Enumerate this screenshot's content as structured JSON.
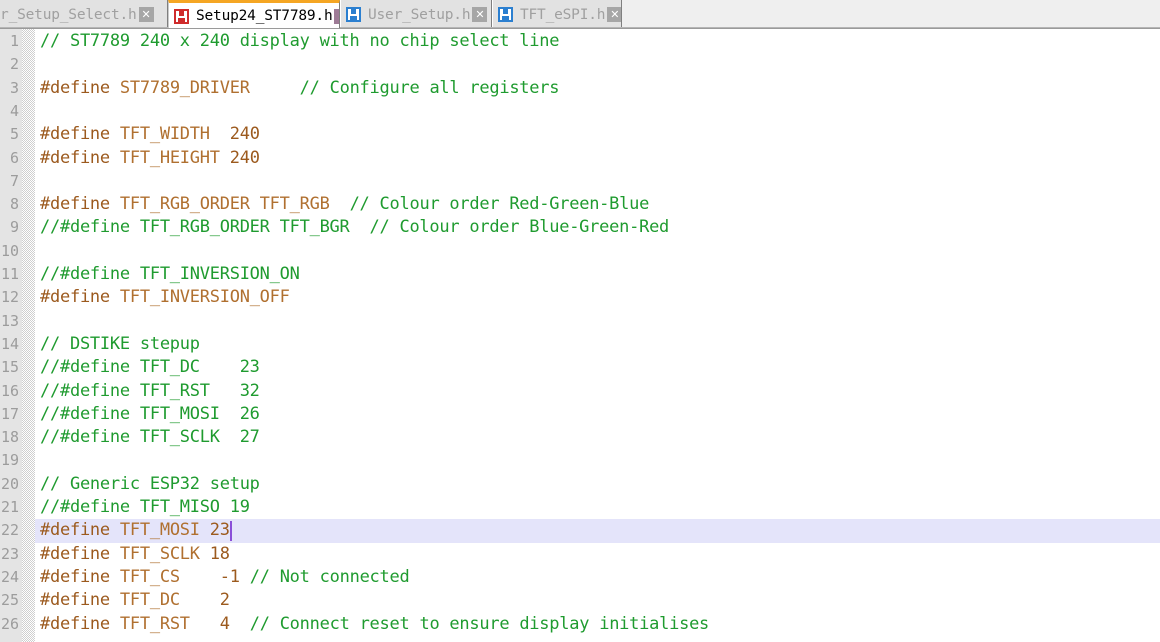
{
  "window": {
    "title": "Setup24_ST7789.h",
    "accent_color": "#f5a623",
    "current_line_highlight_color": "#e4e4fa",
    "caret_color": "#8a4fd8"
  },
  "tabbar": {
    "tabs": [
      {
        "label": "ser_Setup_Select.h",
        "full_label": "User_Setup_Select.h",
        "active": false,
        "clipped": true,
        "icon": "floppy-disk-icon",
        "icon_color": "#2b7fd0",
        "close_label": "✕"
      },
      {
        "label": "Setup24_ST7789.h",
        "active": true,
        "clipped": false,
        "icon": "floppy-disk-icon",
        "icon_color": "#cf2b2b",
        "close_label": "✕"
      },
      {
        "label": "User_Setup.h",
        "active": false,
        "clipped": false,
        "icon": "floppy-disk-icon",
        "icon_color": "#2b7fd0",
        "close_label": "✕"
      },
      {
        "label": "TFT_eSPI.h",
        "active": false,
        "clipped": false,
        "icon": "floppy-disk-icon",
        "icon_color": "#2b7fd0",
        "close_label": "✕"
      }
    ]
  },
  "editor": {
    "current_line": 22,
    "caret_column": 20,
    "line_numbers": [
      "1",
      "2",
      "3",
      "4",
      "5",
      "6",
      "7",
      "8",
      "9",
      "10",
      "11",
      "12",
      "13",
      "14",
      "15",
      "16",
      "17",
      "18",
      "19",
      "20",
      "21",
      "22",
      "23",
      "24",
      "25",
      "26"
    ],
    "lines": [
      {
        "n": 1,
        "tokens": [
          {
            "t": "// ST7789 240 x 240 display with no chip select line",
            "c": "com"
          }
        ]
      },
      {
        "n": 2,
        "tokens": []
      },
      {
        "n": 3,
        "tokens": [
          {
            "t": "#define ",
            "c": "pre"
          },
          {
            "t": "ST7789_DRIVER",
            "c": "id"
          },
          {
            "t": "     ",
            "c": "pln"
          },
          {
            "t": "// Configure all registers",
            "c": "com"
          }
        ]
      },
      {
        "n": 4,
        "tokens": []
      },
      {
        "n": 5,
        "tokens": [
          {
            "t": "#define ",
            "c": "pre"
          },
          {
            "t": "TFT_WIDTH",
            "c": "id"
          },
          {
            "t": "  ",
            "c": "pln"
          },
          {
            "t": "240",
            "c": "num"
          }
        ]
      },
      {
        "n": 6,
        "tokens": [
          {
            "t": "#define ",
            "c": "pre"
          },
          {
            "t": "TFT_HEIGHT",
            "c": "id"
          },
          {
            "t": " ",
            "c": "pln"
          },
          {
            "t": "240",
            "c": "num"
          }
        ]
      },
      {
        "n": 7,
        "tokens": []
      },
      {
        "n": 8,
        "tokens": [
          {
            "t": "#define ",
            "c": "pre"
          },
          {
            "t": "TFT_RGB_ORDER TFT_RGB",
            "c": "id"
          },
          {
            "t": "  ",
            "c": "pln"
          },
          {
            "t": "// Colour order Red-Green-Blue",
            "c": "com"
          }
        ]
      },
      {
        "n": 9,
        "tokens": [
          {
            "t": "//#define TFT_RGB_ORDER TFT_BGR  // Colour order Blue-Green-Red",
            "c": "com"
          }
        ]
      },
      {
        "n": 10,
        "tokens": []
      },
      {
        "n": 11,
        "tokens": [
          {
            "t": "//#define TFT_INVERSION_ON",
            "c": "com"
          }
        ]
      },
      {
        "n": 12,
        "tokens": [
          {
            "t": "#define ",
            "c": "pre"
          },
          {
            "t": "TFT_INVERSION_OFF",
            "c": "id"
          }
        ]
      },
      {
        "n": 13,
        "tokens": []
      },
      {
        "n": 14,
        "tokens": [
          {
            "t": "// DSTIKE stepup",
            "c": "com"
          }
        ]
      },
      {
        "n": 15,
        "tokens": [
          {
            "t": "//#define TFT_DC    23",
            "c": "com"
          }
        ]
      },
      {
        "n": 16,
        "tokens": [
          {
            "t": "//#define TFT_RST   32",
            "c": "com"
          }
        ]
      },
      {
        "n": 17,
        "tokens": [
          {
            "t": "//#define TFT_MOSI  26",
            "c": "com"
          }
        ]
      },
      {
        "n": 18,
        "tokens": [
          {
            "t": "//#define TFT_SCLK  27",
            "c": "com"
          }
        ]
      },
      {
        "n": 19,
        "tokens": []
      },
      {
        "n": 20,
        "tokens": [
          {
            "t": "// Generic ESP32 setup",
            "c": "com"
          }
        ]
      },
      {
        "n": 21,
        "tokens": [
          {
            "t": "//#define TFT_MISO 19",
            "c": "com"
          }
        ]
      },
      {
        "n": 22,
        "tokens": [
          {
            "t": "#define ",
            "c": "pre"
          },
          {
            "t": "TFT_MOSI",
            "c": "id"
          },
          {
            "t": " ",
            "c": "pln"
          },
          {
            "t": "23",
            "c": "num"
          }
        ]
      },
      {
        "n": 23,
        "tokens": [
          {
            "t": "#define ",
            "c": "pre"
          },
          {
            "t": "TFT_SCLK",
            "c": "id"
          },
          {
            "t": " ",
            "c": "pln"
          },
          {
            "t": "18",
            "c": "num"
          }
        ]
      },
      {
        "n": 24,
        "tokens": [
          {
            "t": "#define ",
            "c": "pre"
          },
          {
            "t": "TFT_CS",
            "c": "id"
          },
          {
            "t": "    ",
            "c": "pln"
          },
          {
            "t": "-1 ",
            "c": "num"
          },
          {
            "t": "// Not connected",
            "c": "com"
          }
        ]
      },
      {
        "n": 25,
        "tokens": [
          {
            "t": "#define ",
            "c": "pre"
          },
          {
            "t": "TFT_DC",
            "c": "id"
          },
          {
            "t": "    ",
            "c": "pln"
          },
          {
            "t": "2",
            "c": "num"
          }
        ]
      },
      {
        "n": 26,
        "tokens": [
          {
            "t": "#define ",
            "c": "pre"
          },
          {
            "t": "TFT_RST",
            "c": "id"
          },
          {
            "t": "   ",
            "c": "pln"
          },
          {
            "t": "4  ",
            "c": "num"
          },
          {
            "t": "// Connect reset to ensure display initialises",
            "c": "com"
          }
        ]
      }
    ]
  }
}
